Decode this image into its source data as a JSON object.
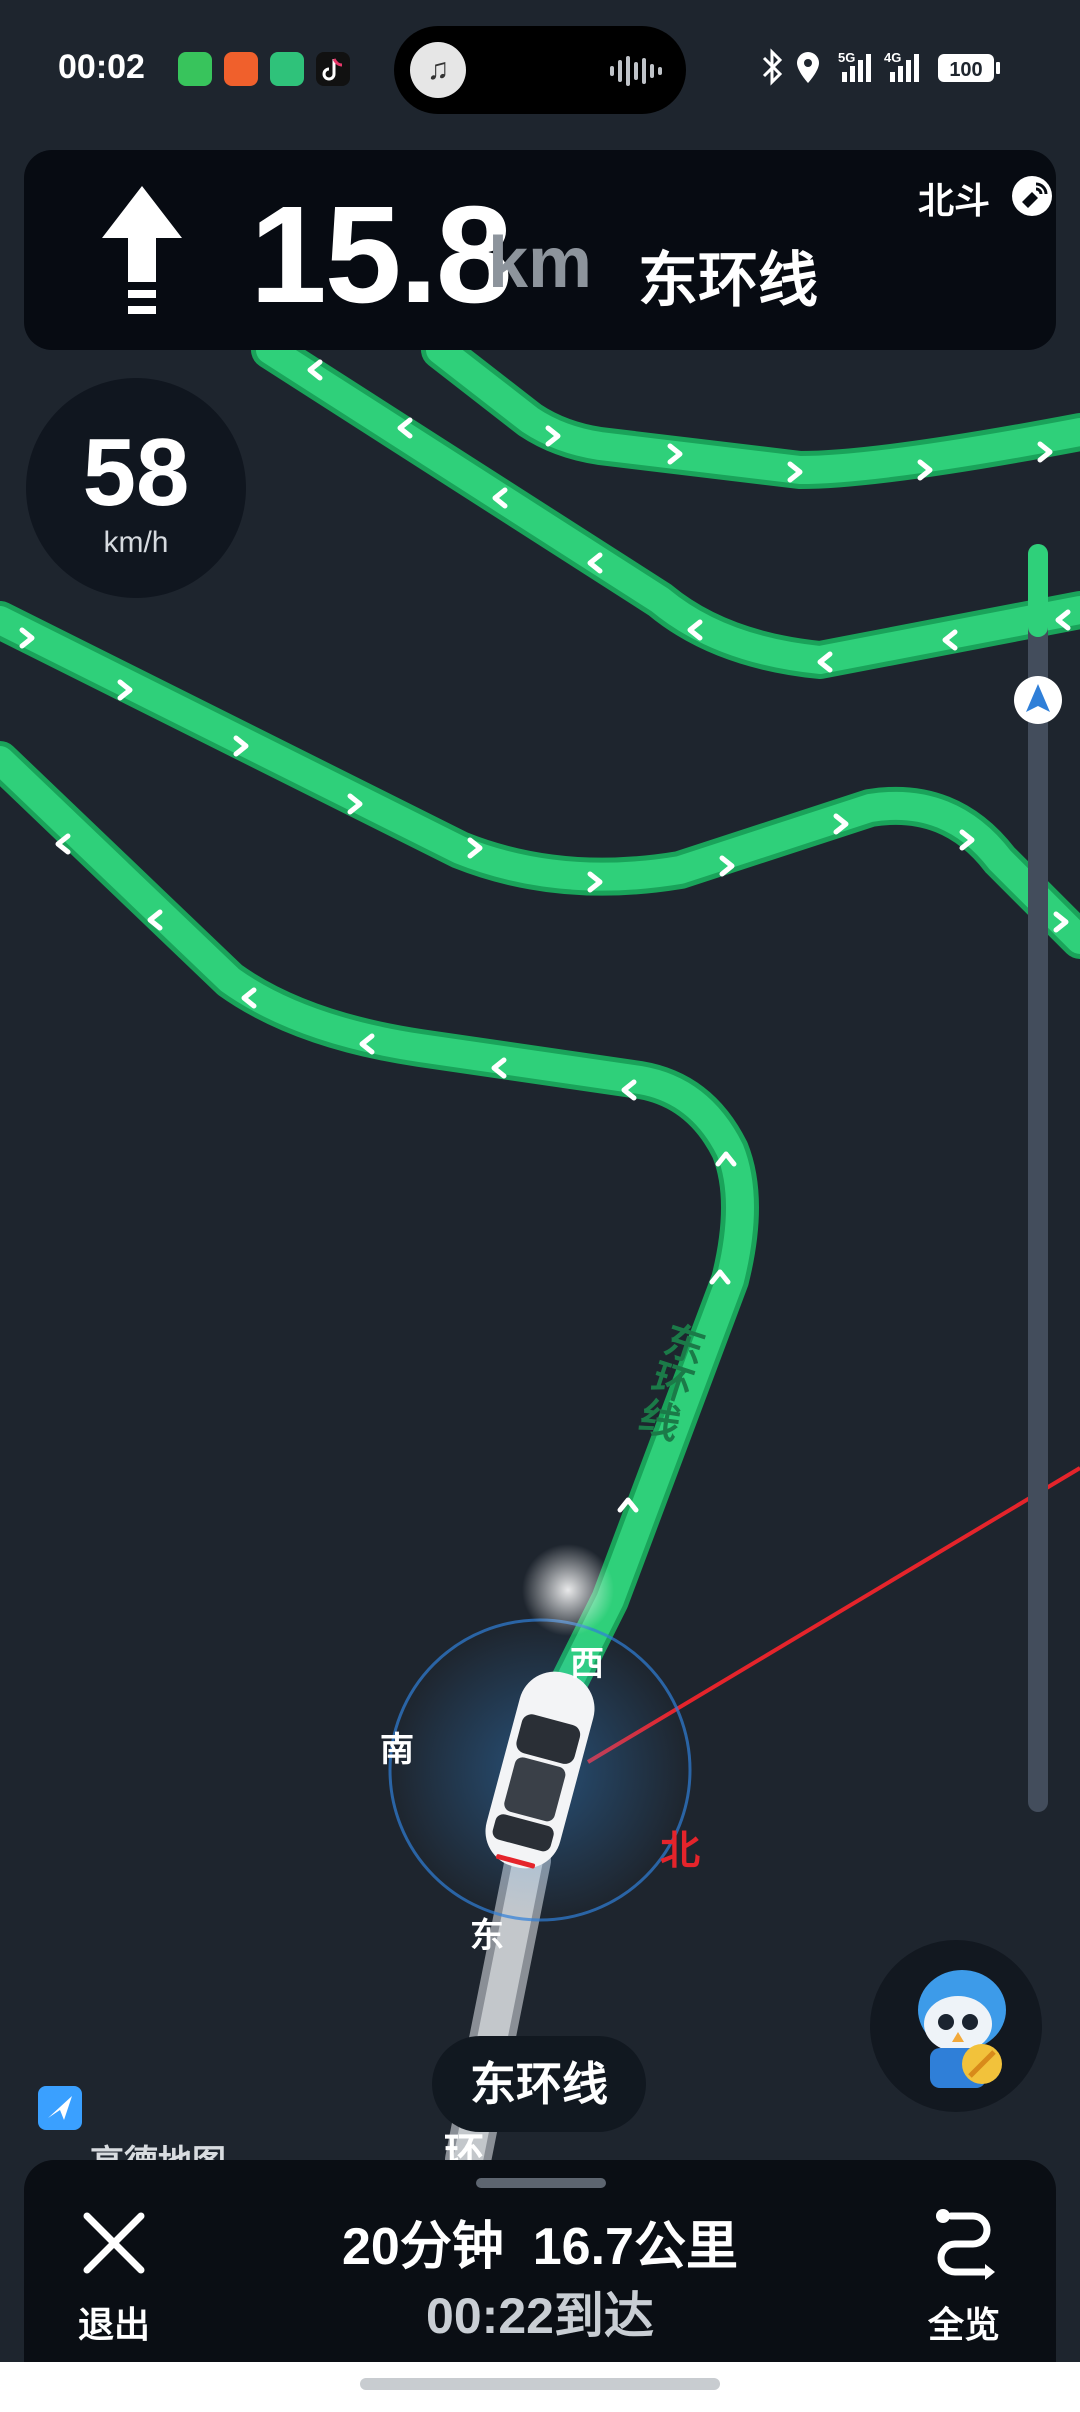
{
  "status_bar": {
    "time": "00:02",
    "network_5g": "5G",
    "network_4g": "4G",
    "battery": "100",
    "app_icons": [
      "messages-app-icon",
      "photo-app-icon",
      "battery-app-icon",
      "tiktok-app-icon"
    ]
  },
  "guidance": {
    "direction": "straight",
    "distance": "15.8",
    "unit": "km",
    "road": "东环线",
    "satellite": "北斗"
  },
  "speed": {
    "value": "58",
    "unit": "km/h"
  },
  "route_progress": 0.035,
  "map": {
    "road_label": "东环线",
    "road_label_lower": "环",
    "compass": {
      "west": "西",
      "south": "南",
      "north": "北",
      "east": "东"
    }
  },
  "current_road_chip": "东环线",
  "logo": "高德地图",
  "bottom": {
    "exit_label": "退出",
    "duration": "20分钟",
    "distance": "16.7公里",
    "arrival": "00:22到达",
    "overview_label": "全览"
  },
  "colors": {
    "route_green": "#2fd07a",
    "route_border": "#1aa35a",
    "map_bg": "#1e252e",
    "north_red": "#e5242b",
    "progress_track": "#434d5c"
  }
}
